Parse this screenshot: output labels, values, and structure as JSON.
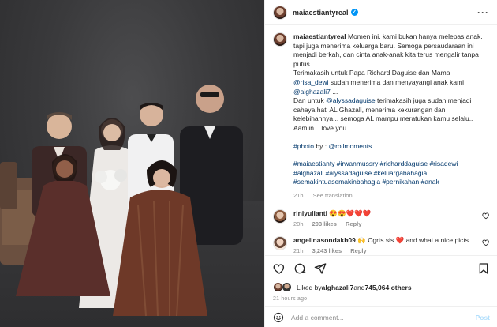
{
  "post": {
    "username": "maiaestiantyreal",
    "verified_mark": "✓",
    "more_icon": "more-horizontal-icon"
  },
  "caption": {
    "username": "maiaestiantyreal",
    "line1": " Momen ini, kami bukan hanya melepas anak, tapi juga menerima keluarga baru. Semoga persaudaraan ini menjadi berkah, dan cinta anak-anak kita terus mengalir tanpa putus...",
    "line2a": "Terimakasih untuk Papa Richard Daguise dan Mama ",
    "mention1": "@risa_dewi",
    "line2b": " sudah menerima dan menyayangi anak kami ",
    "mention2": "@alghazali7",
    "line2c": " ...",
    "line3a": "Dan untuk ",
    "mention3": "@alyssadaguise",
    "line3b": " terimakasih juga sudah menjadi cahaya hati AL Ghazali, menerima kekurangan dan kelebihannya... semoga AL mampu meratukan kamu selalu.. Aamiin....love you....",
    "photo_hashtag": "#photo",
    "photo_by": " by : ",
    "mention4": "@rollmoments",
    "hashtags": "#maiaestianty #irwanmussry #richarddaguise #risadewi #alghazali #alyssadaguise #keluargabahagia #semakintuasemakinbahagia #pernikahan #anak",
    "time": "21h",
    "see_translation": "See translation"
  },
  "comments": [
    {
      "username": "riniyulianti",
      "text": "😍😍❤️❤️❤️",
      "time": "20h",
      "likes": "203 likes",
      "reply": "Reply"
    },
    {
      "username": "angelinasondakh09",
      "text": "🙌 Cgrts sis ❤️ and what a nice picts",
      "time": "21h",
      "likes": "3,243 likes",
      "reply": "Reply"
    }
  ],
  "likes": {
    "prefix": "Liked by ",
    "user": "alghazali7",
    "mid": " and ",
    "count": "745,064 others"
  },
  "timestamp": "21 hours ago",
  "add_comment": {
    "placeholder": "Add a comment...",
    "post_label": "Post"
  },
  "colors": {
    "link": "#00376b",
    "verified": "#0095f6",
    "muted": "#8e8e8e",
    "heart": "#ed4956"
  }
}
